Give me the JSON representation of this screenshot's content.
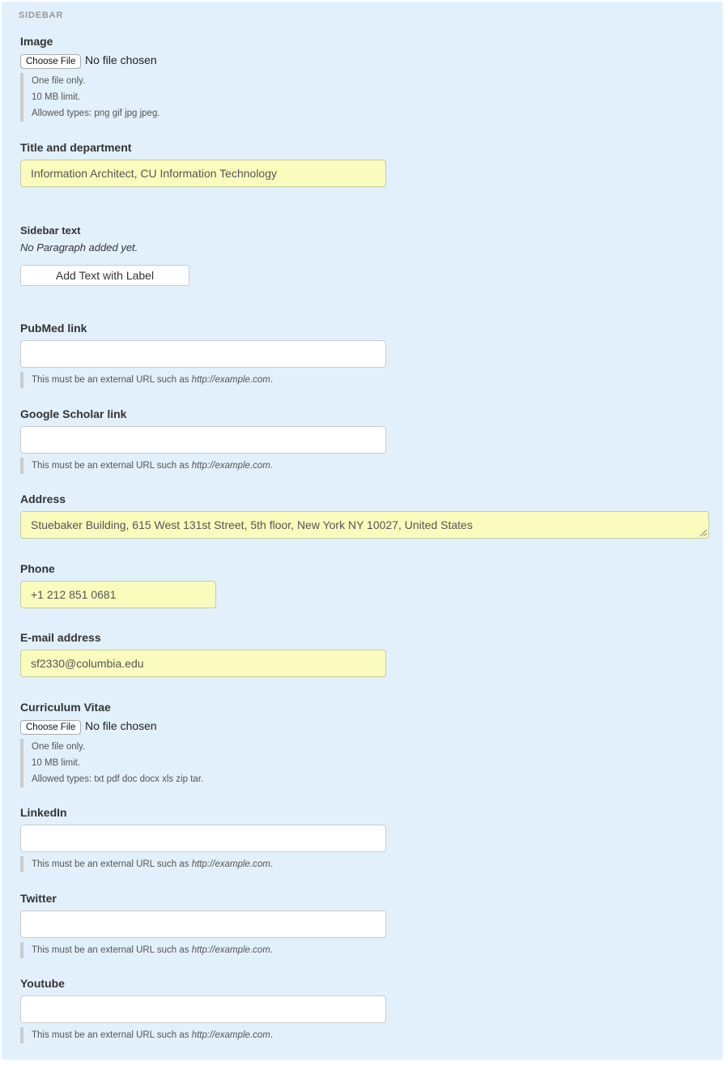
{
  "section_legend": "SIDEBAR",
  "image": {
    "label": "Image",
    "choose_label": "Choose File",
    "status": "No file chosen",
    "help": [
      "One file only.",
      "10 MB limit.",
      "Allowed types: png gif jpg jpeg."
    ]
  },
  "title_department": {
    "label": "Title and department",
    "value": "Information Architect, CU Information Technology"
  },
  "sidebar_text": {
    "label": "Sidebar text",
    "empty_note": "No Paragraph added yet.",
    "add_button": "Add Text with Label"
  },
  "url_help": {
    "prefix": "This must be an external URL such as ",
    "example": "http://example.com",
    "suffix": "."
  },
  "pubmed": {
    "label": "PubMed link",
    "value": ""
  },
  "google_scholar": {
    "label": "Google Scholar link",
    "value": ""
  },
  "address": {
    "label": "Address",
    "value": "Stuebaker Building, 615 West 131st Street, 5th floor, New York NY 10027, United States"
  },
  "phone": {
    "label": "Phone",
    "value": "+1 212 851 0681"
  },
  "email": {
    "label": "E-mail address",
    "value": "sf2330@columbia.edu"
  },
  "cv": {
    "label": "Curriculum Vitae",
    "choose_label": "Choose File",
    "status": "No file chosen",
    "help": [
      "One file only.",
      "10 MB limit.",
      "Allowed types: txt pdf doc docx xls zip tar."
    ]
  },
  "linkedin": {
    "label": "LinkedIn",
    "value": ""
  },
  "twitter": {
    "label": "Twitter",
    "value": ""
  },
  "youtube": {
    "label": "Youtube",
    "value": ""
  }
}
